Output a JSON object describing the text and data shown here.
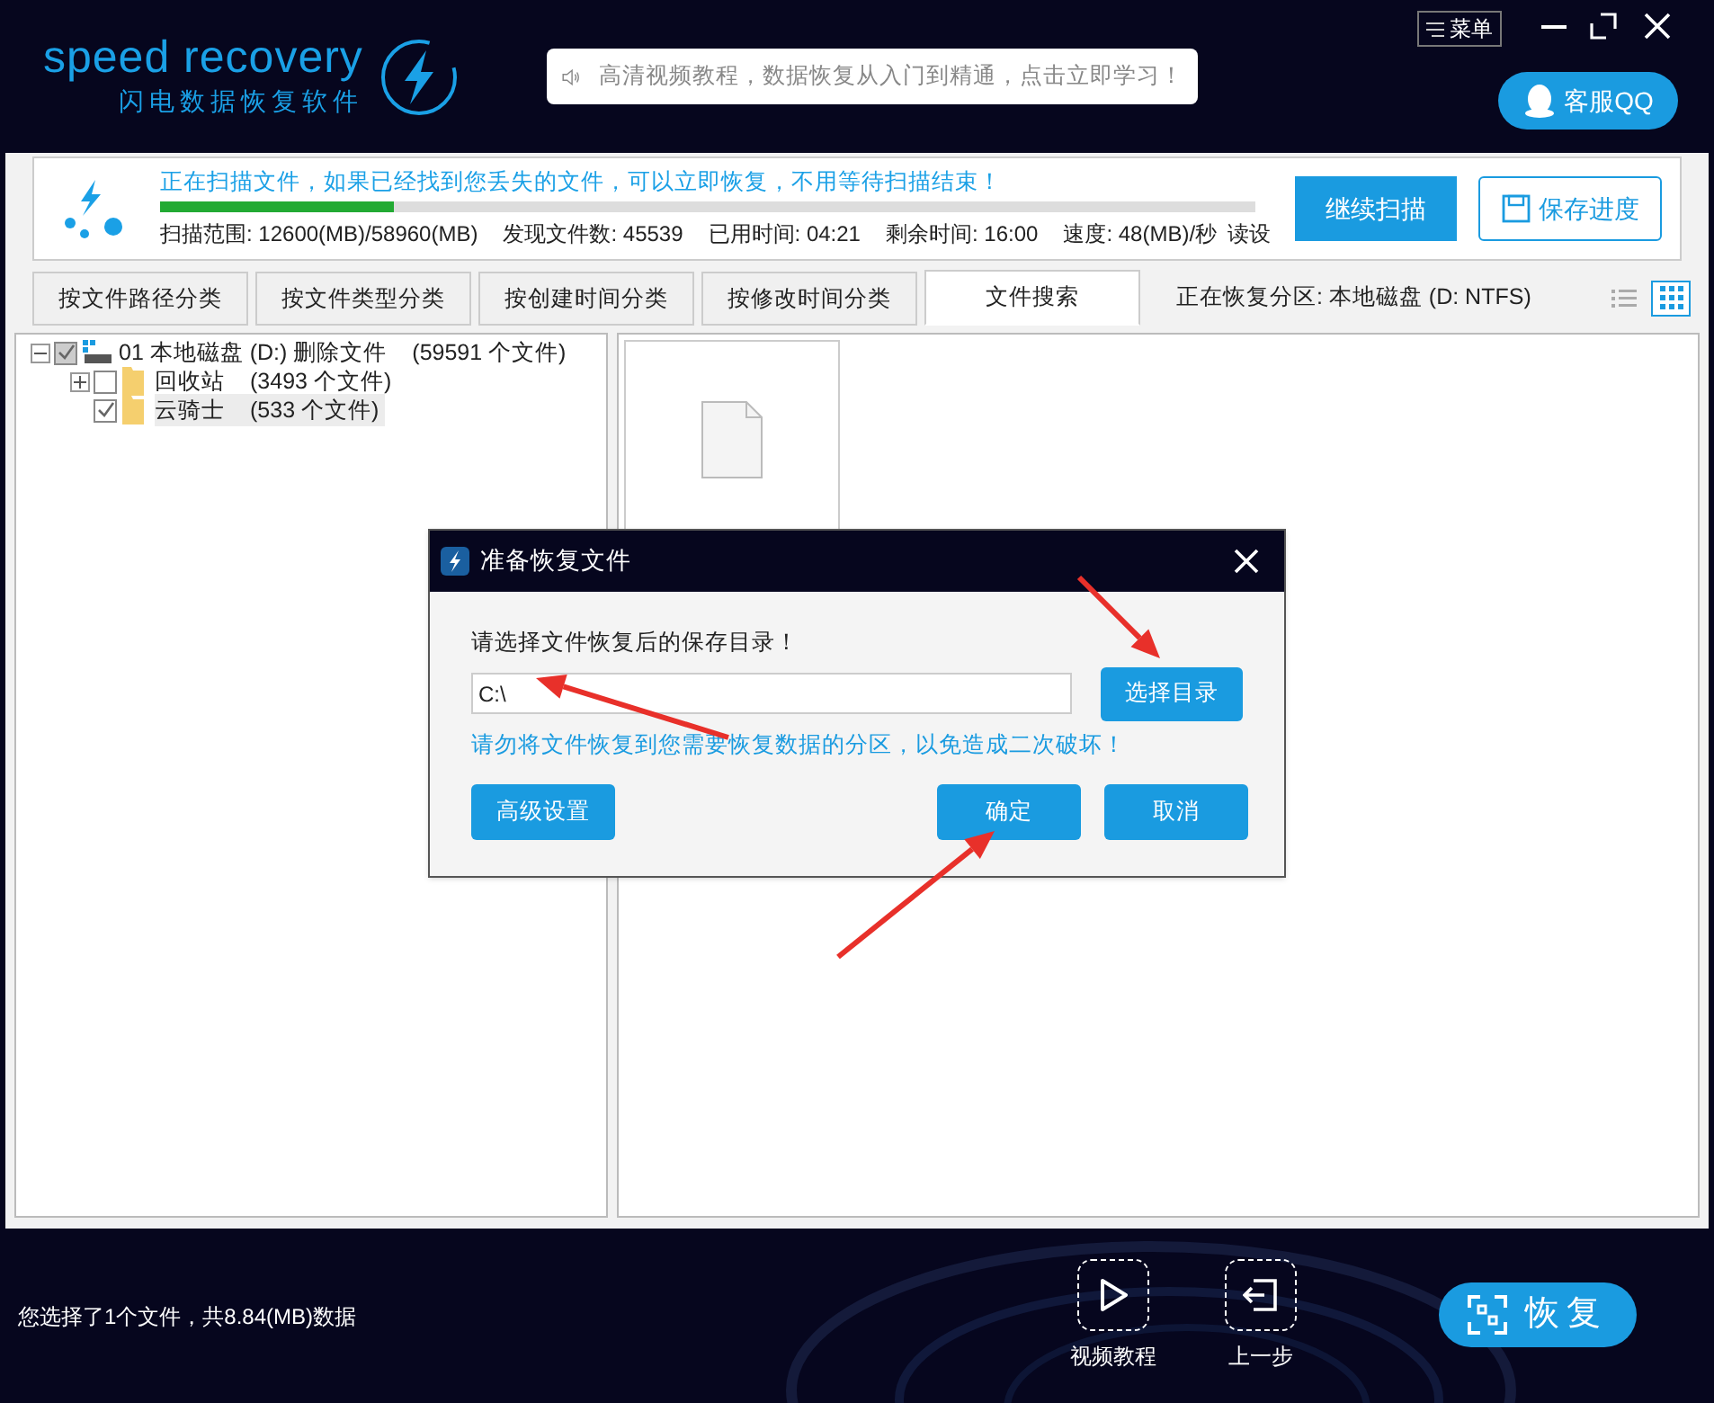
{
  "header": {
    "logo_title": "speed recovery",
    "logo_subtitle": "闪电数据恢复软件",
    "notice": "高清视频教程，数据恢复从入门到精通，点击立即学习！",
    "menu": "菜单",
    "support": "客服QQ"
  },
  "scan": {
    "message": "正在扫描文件，如果已经找到您丢失的文件，可以立即恢复，不用等待扫描结束！",
    "level": 0.214,
    "stats": [
      {
        "label": "扫描范围:",
        "value": "12600(MB)/58960(MB)"
      },
      {
        "label": "发现文件数:",
        "value": "45539"
      },
      {
        "label": "已用时间:",
        "value": "04:21"
      },
      {
        "label": "剩余时间:",
        "value": "16:00"
      },
      {
        "label": "速度:",
        "value": "48(MB)/秒"
      }
    ],
    "status": "读设",
    "buttons": [
      "继续扫描",
      "保存进度"
    ]
  },
  "tabs": [
    {
      "label": "按文件路径分类",
      "selected": false
    },
    {
      "label": "按文件类型分类",
      "selected": false
    },
    {
      "label": "按创建时间分类",
      "selected": false
    },
    {
      "label": "按修改时间分类",
      "selected": false
    },
    {
      "label": "文件搜索",
      "selected": true
    }
  ],
  "partition": "正在恢复分区: 本地磁盘 (D: NTFS)",
  "view_modes": [
    {
      "kind": "list",
      "selected": false
    },
    {
      "kind": "grid",
      "selected": true
    }
  ],
  "tree": [
    {
      "kind": "disk",
      "label": "01 本地磁盘 (D:) 删除文件",
      "count": "(59591 个文件)",
      "checked": true,
      "expanded": true,
      "selected": false,
      "children": [
        {
          "kind": "folder",
          "label": "回收站",
          "count": "(3493 个文件)",
          "checked": false,
          "expanded": false,
          "selected": false
        },
        {
          "kind": "folder",
          "label": "云骑士",
          "count": "(533 个文件)",
          "checked": true,
          "selected": true
        }
      ]
    }
  ],
  "dialog": {
    "title": "准备恢复文件",
    "prompt": "请选择文件恢复后的保存目录！",
    "path": "C:\\",
    "browse": "选择目录",
    "warning": "请勿将文件恢复到您需要恢复数据的分区，以免造成二次破坏！",
    "advanced": "高级设置",
    "ok": "确定",
    "cancel": "取消"
  },
  "footer": {
    "selection": "您选择了1个文件，共8.84(MB)数据",
    "actions": [
      {
        "kind": "play",
        "label": "视频教程"
      },
      {
        "kind": "back",
        "label": "上一步"
      }
    ],
    "recover": "恢复"
  }
}
